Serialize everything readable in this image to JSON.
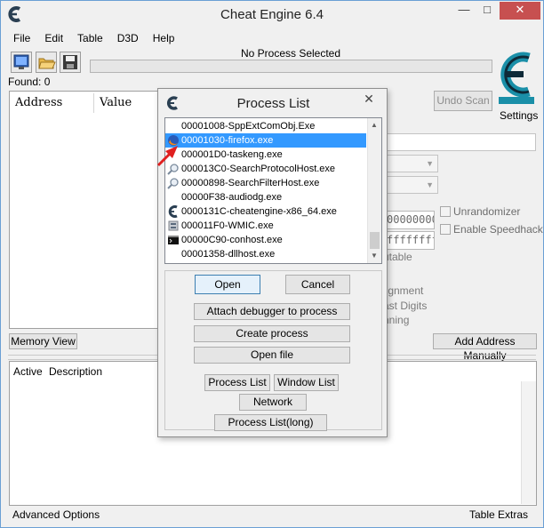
{
  "window": {
    "title": "Cheat Engine 6.4",
    "minimize_glyph": "—",
    "maximize_glyph": "□",
    "close_glyph": "✕"
  },
  "menu": [
    "File",
    "Edit",
    "Table",
    "D3D",
    "Help"
  ],
  "toolbar": {
    "icons": [
      "open-process-icon",
      "open-file-icon",
      "save-icon"
    ]
  },
  "status": {
    "process": "No Process Selected",
    "found": "Found: 0"
  },
  "address_list": {
    "columns": [
      "Address",
      "Value"
    ]
  },
  "scan_panel": {
    "undo_scan": "Undo Scan",
    "settings": "Settings",
    "hex_start": "00000000",
    "hex_stop": "ffffffff",
    "executable": "utable",
    "alignment": "lignment",
    "last_digits": "ast Digits",
    "running": "nning",
    "unrandomizer": "Unrandomizer",
    "enable_speedhack": "Enable Speedhack"
  },
  "buttons": {
    "memory_view": "Memory View",
    "add_address": "Add Address Manually"
  },
  "cheat_table": {
    "active": "Active",
    "description": "Description"
  },
  "footer": {
    "advanced_options": "Advanced Options",
    "table_extras": "Table Extras"
  },
  "dialog": {
    "title": "Process List",
    "close_glyph": "✕",
    "processes": [
      {
        "name": "00001008-SppExtComObj.Exe",
        "icon": "none"
      },
      {
        "name": "00001030-firefox.exe",
        "icon": "firefox-icon",
        "selected": true
      },
      {
        "name": "000001D0-taskeng.exe",
        "icon": "none"
      },
      {
        "name": "000013C0-SearchProtocolHost.exe",
        "icon": "search-icon"
      },
      {
        "name": "00000898-SearchFilterHost.exe",
        "icon": "search-icon"
      },
      {
        "name": "00000F38-audiodg.exe",
        "icon": "none"
      },
      {
        "name": "0000131C-cheatengine-x86_64.exe",
        "icon": "cheatengine-icon"
      },
      {
        "name": "000011F0-WMIC.exe",
        "icon": "wmic-icon"
      },
      {
        "name": "00000C90-conhost.exe",
        "icon": "console-icon"
      },
      {
        "name": "00001358-dllhost.exe",
        "icon": "none"
      }
    ],
    "open": "Open",
    "cancel": "Cancel",
    "attach_debugger": "Attach debugger to process",
    "create_process": "Create process",
    "open_file": "Open file",
    "process_list": "Process List",
    "window_list": "Window List",
    "network": "Network",
    "process_list_long": "Process List(long)"
  },
  "colors": {
    "selection": "#3399ff",
    "close_button": "#c75050",
    "annotation_arrow": "#e02020",
    "logo": "#1a8fa8"
  }
}
